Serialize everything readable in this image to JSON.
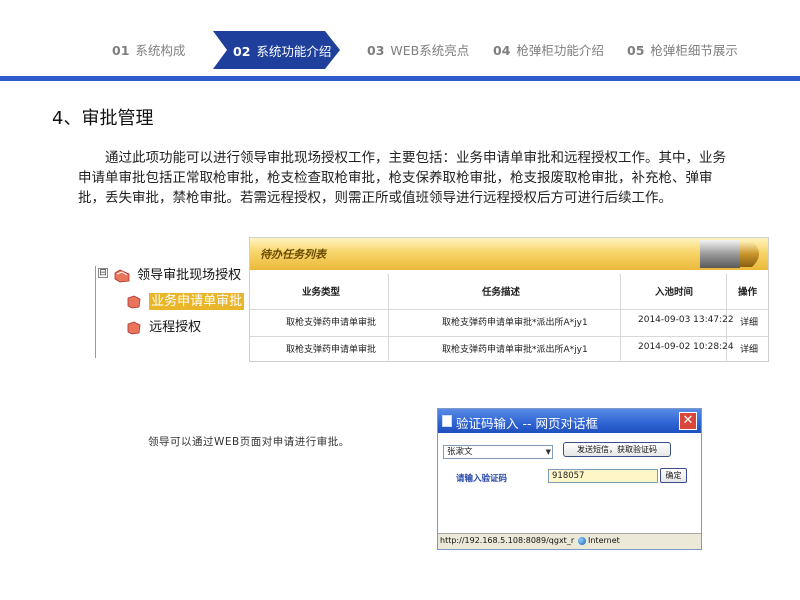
{
  "nav": {
    "items": [
      {
        "num": "01",
        "label": "系统构成"
      },
      {
        "num": "02",
        "label": "系统功能介绍"
      },
      {
        "num": "03",
        "label": "WEB系统亮点"
      },
      {
        "num": "04",
        "label": "枪弹柜功能介绍"
      },
      {
        "num": "05",
        "label": "枪弹柜细节展示"
      }
    ],
    "active_index": 1,
    "accent_color": "#2f5bcb"
  },
  "section": {
    "title": "4、审批管理",
    "intro": "通过此项功能可以进行领导审批现场授权工作，主要包括：业务申请单审批和远程授权工作。其中，业务申请单审批包括正常取枪审批，枪支检查取枪审批，枪支保养取枪审批，枪支报废取枪审批，补充枪、弹审批，丢失审批，禁枪审批。若需远程授权，则需正所或值班领导进行远程授权后方可进行后续工作。"
  },
  "tree": {
    "toggle": "⊟",
    "root": "领导审批现场授权",
    "children": [
      "业务申请单审批",
      "远程授权"
    ],
    "selected_index": 0
  },
  "task_table": {
    "title": "待办任务列表",
    "columns": [
      "业务类型",
      "任务描述",
      "入池时间",
      "操作"
    ],
    "rows": [
      {
        "type": "取枪支弹药申请单审批",
        "desc": "取枪支弹药申请单审批*派出所A*jy1",
        "time": "2014-09-03 13:47:22",
        "action": "详细"
      },
      {
        "type": "取枪支弹药申请单审批",
        "desc": "取枪支弹药申请单审批*派出所A*jy1",
        "time": "2014-09-02 10:28:24",
        "action": "详细"
      }
    ]
  },
  "caption": "领导可以通过WEB页面对申请进行审批。",
  "dialog": {
    "title": "验证码输入 -- 网页对话框",
    "close": "✕",
    "select_value": "张漱文",
    "send_button": "发送短信，获取验证码",
    "code_label": "请输入验证码",
    "code_value": "918057",
    "ok_button": "确定",
    "status_url": "http://192.168.5.108:8089/qgxt_r",
    "status_zone": "Internet"
  }
}
